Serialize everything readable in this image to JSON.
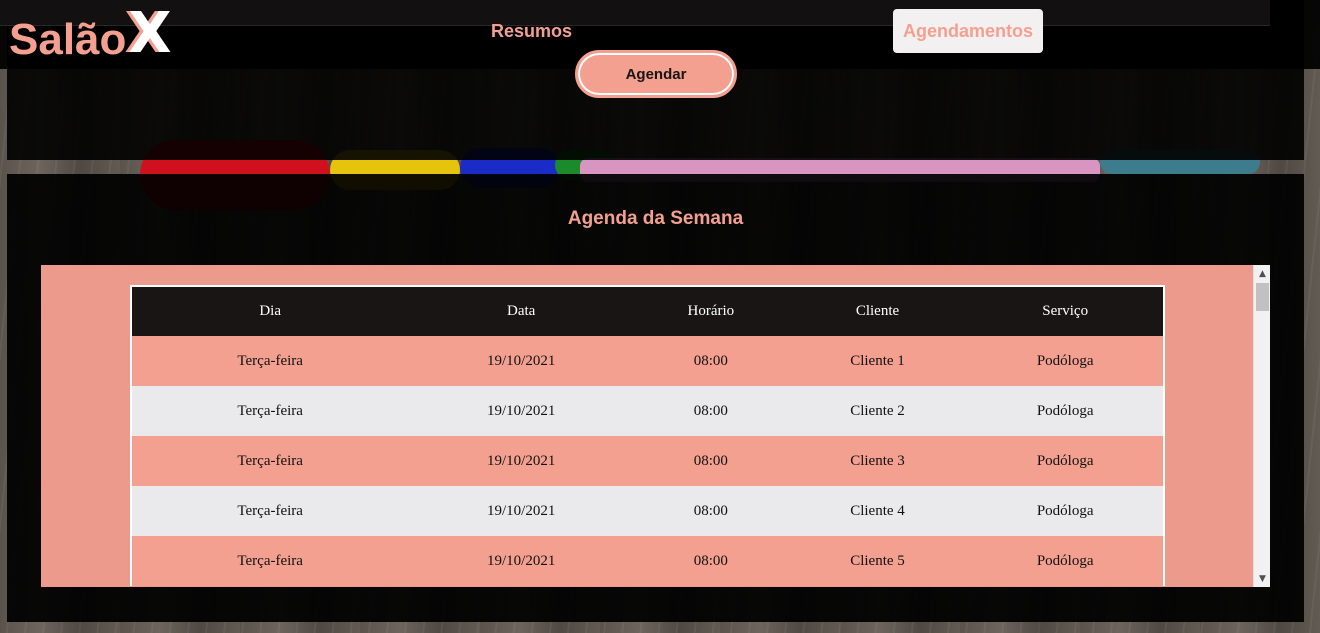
{
  "brand": {
    "name_main": "Salão",
    "name_mark": "X"
  },
  "nav": {
    "resumos_label": "Resumos",
    "agendamentos_label": "Agendamentos"
  },
  "actions": {
    "agendar_label": "Agendar"
  },
  "agenda": {
    "title": "Agenda da Semana",
    "columns": [
      "Dia",
      "Data",
      "Horário",
      "Cliente",
      "Serviço"
    ],
    "rows": [
      [
        "Terça-feira",
        "19/10/2021",
        "08:00",
        "Cliente 1",
        "Podóloga"
      ],
      [
        "Terça-feira",
        "19/10/2021",
        "08:00",
        "Cliente 2",
        "Podóloga"
      ],
      [
        "Terça-feira",
        "19/10/2021",
        "08:00",
        "Cliente 3",
        "Podóloga"
      ],
      [
        "Terça-feira",
        "19/10/2021",
        "08:00",
        "Cliente 4",
        "Podóloga"
      ],
      [
        "Terça-feira",
        "19/10/2021",
        "08:00",
        "Cliente 5",
        "Podóloga"
      ]
    ]
  },
  "colors": {
    "accent": "#f4a090",
    "panel": "#000000",
    "row_alt": "#eaeaec"
  }
}
